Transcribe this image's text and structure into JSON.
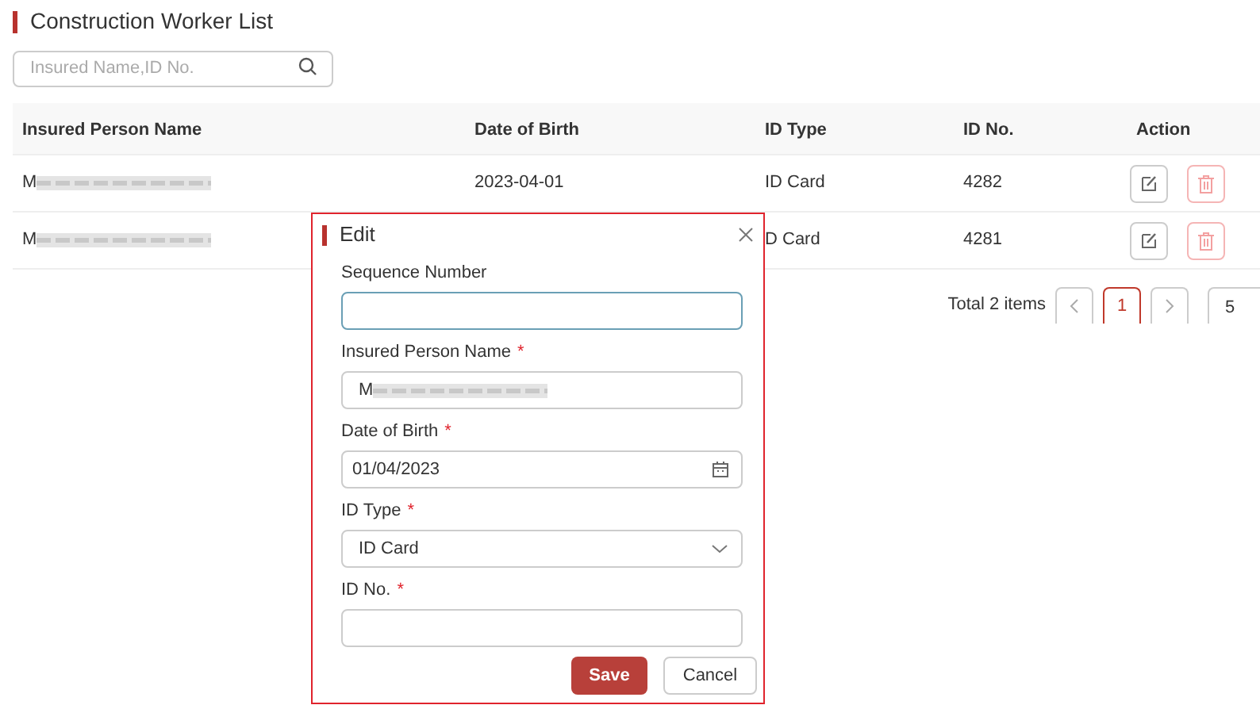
{
  "page_title": "Construction Worker List",
  "search": {
    "placeholder": "Insured Name,ID No."
  },
  "table": {
    "columns": [
      "Insured Person Name",
      "Date of Birth",
      "ID Type",
      "ID No.",
      "Action"
    ],
    "rows": [
      {
        "name": "M",
        "name_redacted": true,
        "date_of_birth": "2023-04-01",
        "id_type": "ID Card",
        "id_no": "4282"
      },
      {
        "name": "M",
        "name_redacted": true,
        "id_type": "D Card",
        "id_no": "4281"
      }
    ]
  },
  "pagination": {
    "total": "Total 2 items",
    "pages": [
      {
        "label": "1",
        "selected": true
      }
    ],
    "page_size": "5"
  },
  "dialog": {
    "title": "Edit",
    "fields": [
      {
        "kind": "text",
        "label": "Sequence Number",
        "focused": true
      },
      {
        "kind": "text",
        "label": "Insured Person Name",
        "required_mark": "*",
        "focused": false,
        "value": "M",
        "redacted": true
      },
      {
        "kind": "date",
        "label": "Date of Birth",
        "required_mark": "*",
        "focused": false,
        "value": "01/04/2023"
      },
      {
        "kind": "select",
        "label": "ID Type",
        "required_mark": "*",
        "focused": false,
        "value": "ID Card"
      },
      {
        "kind": "text",
        "label": "ID No.",
        "required_mark": "*",
        "focused": false
      }
    ],
    "buttons": [
      {
        "label": "Save",
        "primary": true
      },
      {
        "label": "Cancel",
        "primary": false
      }
    ]
  }
}
